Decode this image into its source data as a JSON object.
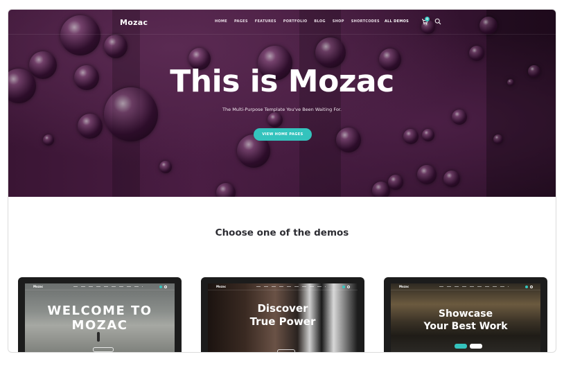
{
  "nav": {
    "logo": "Mozac",
    "menu": [
      "HOME",
      "PAGES",
      "FEATURES",
      "PORTFOLIO",
      "BLOG",
      "SHOP",
      "SHORTCODES"
    ],
    "all_demos": "ALL DEMOS",
    "cart_count": "0",
    "icons": [
      "cart-icon",
      "search-icon"
    ]
  },
  "hero": {
    "title": "This is Mozac",
    "subtitle": "The Multi-Purpose Template You've Been Waiting For.",
    "button": "VIEW HOME PAGES"
  },
  "section": {
    "title": "Choose one of the demos"
  },
  "demos": [
    {
      "logo": "Mozac",
      "heading_line1": "WELCOME TO",
      "heading_line2": "MOZAC"
    },
    {
      "logo": "Mozac",
      "heading_line1": "Discover",
      "heading_line2": "True Power"
    },
    {
      "logo": "Mozac",
      "heading_line1": "Showcase",
      "heading_line2": "Your Best Work"
    }
  ],
  "colors": {
    "accent": "#34c3bd",
    "hero_bg": "#3a1534",
    "heading_dark": "#2d2d33"
  }
}
